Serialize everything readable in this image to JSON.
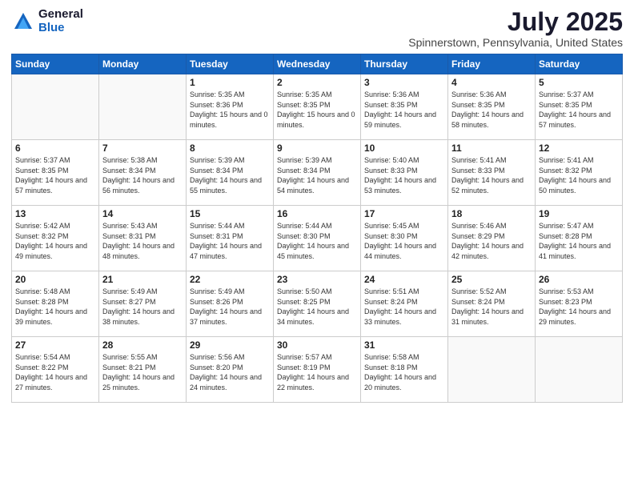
{
  "logo": {
    "general": "General",
    "blue": "Blue"
  },
  "title": "July 2025",
  "subtitle": "Spinnerstown, Pennsylvania, United States",
  "weekdays": [
    "Sunday",
    "Monday",
    "Tuesday",
    "Wednesday",
    "Thursday",
    "Friday",
    "Saturday"
  ],
  "weeks": [
    [
      {
        "day": "",
        "sunrise": "",
        "sunset": "",
        "daylight": ""
      },
      {
        "day": "",
        "sunrise": "",
        "sunset": "",
        "daylight": ""
      },
      {
        "day": "1",
        "sunrise": "Sunrise: 5:35 AM",
        "sunset": "Sunset: 8:36 PM",
        "daylight": "Daylight: 15 hours and 0 minutes."
      },
      {
        "day": "2",
        "sunrise": "Sunrise: 5:35 AM",
        "sunset": "Sunset: 8:35 PM",
        "daylight": "Daylight: 15 hours and 0 minutes."
      },
      {
        "day": "3",
        "sunrise": "Sunrise: 5:36 AM",
        "sunset": "Sunset: 8:35 PM",
        "daylight": "Daylight: 14 hours and 59 minutes."
      },
      {
        "day": "4",
        "sunrise": "Sunrise: 5:36 AM",
        "sunset": "Sunset: 8:35 PM",
        "daylight": "Daylight: 14 hours and 58 minutes."
      },
      {
        "day": "5",
        "sunrise": "Sunrise: 5:37 AM",
        "sunset": "Sunset: 8:35 PM",
        "daylight": "Daylight: 14 hours and 57 minutes."
      }
    ],
    [
      {
        "day": "6",
        "sunrise": "Sunrise: 5:37 AM",
        "sunset": "Sunset: 8:35 PM",
        "daylight": "Daylight: 14 hours and 57 minutes."
      },
      {
        "day": "7",
        "sunrise": "Sunrise: 5:38 AM",
        "sunset": "Sunset: 8:34 PM",
        "daylight": "Daylight: 14 hours and 56 minutes."
      },
      {
        "day": "8",
        "sunrise": "Sunrise: 5:39 AM",
        "sunset": "Sunset: 8:34 PM",
        "daylight": "Daylight: 14 hours and 55 minutes."
      },
      {
        "day": "9",
        "sunrise": "Sunrise: 5:39 AM",
        "sunset": "Sunset: 8:34 PM",
        "daylight": "Daylight: 14 hours and 54 minutes."
      },
      {
        "day": "10",
        "sunrise": "Sunrise: 5:40 AM",
        "sunset": "Sunset: 8:33 PM",
        "daylight": "Daylight: 14 hours and 53 minutes."
      },
      {
        "day": "11",
        "sunrise": "Sunrise: 5:41 AM",
        "sunset": "Sunset: 8:33 PM",
        "daylight": "Daylight: 14 hours and 52 minutes."
      },
      {
        "day": "12",
        "sunrise": "Sunrise: 5:41 AM",
        "sunset": "Sunset: 8:32 PM",
        "daylight": "Daylight: 14 hours and 50 minutes."
      }
    ],
    [
      {
        "day": "13",
        "sunrise": "Sunrise: 5:42 AM",
        "sunset": "Sunset: 8:32 PM",
        "daylight": "Daylight: 14 hours and 49 minutes."
      },
      {
        "day": "14",
        "sunrise": "Sunrise: 5:43 AM",
        "sunset": "Sunset: 8:31 PM",
        "daylight": "Daylight: 14 hours and 48 minutes."
      },
      {
        "day": "15",
        "sunrise": "Sunrise: 5:44 AM",
        "sunset": "Sunset: 8:31 PM",
        "daylight": "Daylight: 14 hours and 47 minutes."
      },
      {
        "day": "16",
        "sunrise": "Sunrise: 5:44 AM",
        "sunset": "Sunset: 8:30 PM",
        "daylight": "Daylight: 14 hours and 45 minutes."
      },
      {
        "day": "17",
        "sunrise": "Sunrise: 5:45 AM",
        "sunset": "Sunset: 8:30 PM",
        "daylight": "Daylight: 14 hours and 44 minutes."
      },
      {
        "day": "18",
        "sunrise": "Sunrise: 5:46 AM",
        "sunset": "Sunset: 8:29 PM",
        "daylight": "Daylight: 14 hours and 42 minutes."
      },
      {
        "day": "19",
        "sunrise": "Sunrise: 5:47 AM",
        "sunset": "Sunset: 8:28 PM",
        "daylight": "Daylight: 14 hours and 41 minutes."
      }
    ],
    [
      {
        "day": "20",
        "sunrise": "Sunrise: 5:48 AM",
        "sunset": "Sunset: 8:28 PM",
        "daylight": "Daylight: 14 hours and 39 minutes."
      },
      {
        "day": "21",
        "sunrise": "Sunrise: 5:49 AM",
        "sunset": "Sunset: 8:27 PM",
        "daylight": "Daylight: 14 hours and 38 minutes."
      },
      {
        "day": "22",
        "sunrise": "Sunrise: 5:49 AM",
        "sunset": "Sunset: 8:26 PM",
        "daylight": "Daylight: 14 hours and 37 minutes."
      },
      {
        "day": "23",
        "sunrise": "Sunrise: 5:50 AM",
        "sunset": "Sunset: 8:25 PM",
        "daylight": "Daylight: 14 hours and 34 minutes."
      },
      {
        "day": "24",
        "sunrise": "Sunrise: 5:51 AM",
        "sunset": "Sunset: 8:24 PM",
        "daylight": "Daylight: 14 hours and 33 minutes."
      },
      {
        "day": "25",
        "sunrise": "Sunrise: 5:52 AM",
        "sunset": "Sunset: 8:24 PM",
        "daylight": "Daylight: 14 hours and 31 minutes."
      },
      {
        "day": "26",
        "sunrise": "Sunrise: 5:53 AM",
        "sunset": "Sunset: 8:23 PM",
        "daylight": "Daylight: 14 hours and 29 minutes."
      }
    ],
    [
      {
        "day": "27",
        "sunrise": "Sunrise: 5:54 AM",
        "sunset": "Sunset: 8:22 PM",
        "daylight": "Daylight: 14 hours and 27 minutes."
      },
      {
        "day": "28",
        "sunrise": "Sunrise: 5:55 AM",
        "sunset": "Sunset: 8:21 PM",
        "daylight": "Daylight: 14 hours and 25 minutes."
      },
      {
        "day": "29",
        "sunrise": "Sunrise: 5:56 AM",
        "sunset": "Sunset: 8:20 PM",
        "daylight": "Daylight: 14 hours and 24 minutes."
      },
      {
        "day": "30",
        "sunrise": "Sunrise: 5:57 AM",
        "sunset": "Sunset: 8:19 PM",
        "daylight": "Daylight: 14 hours and 22 minutes."
      },
      {
        "day": "31",
        "sunrise": "Sunrise: 5:58 AM",
        "sunset": "Sunset: 8:18 PM",
        "daylight": "Daylight: 14 hours and 20 minutes."
      },
      {
        "day": "",
        "sunrise": "",
        "sunset": "",
        "daylight": ""
      },
      {
        "day": "",
        "sunrise": "",
        "sunset": "",
        "daylight": ""
      }
    ]
  ]
}
